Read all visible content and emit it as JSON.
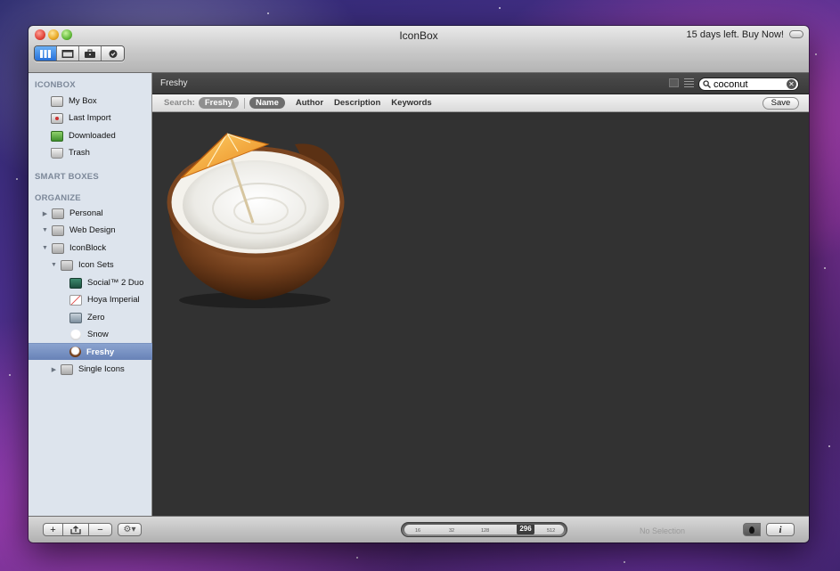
{
  "window": {
    "title": "IconBox",
    "trial_text": "15 days left.  Buy Now!"
  },
  "toolbar": {
    "segments": [
      {
        "icon": "library-icon",
        "active": true
      },
      {
        "icon": "browser-icon",
        "active": false
      },
      {
        "icon": "toolbox-icon",
        "active": false
      },
      {
        "icon": "badge-icon",
        "active": false
      }
    ]
  },
  "sidebar": {
    "sections": {
      "iconbox": "ICONBOX",
      "smart_boxes": "SMART BOXES",
      "organize": "ORGANIZE"
    },
    "iconbox_items": [
      "My Box",
      "Last Import",
      "Downloaded",
      "Trash"
    ],
    "organize_items": [
      {
        "label": "Personal",
        "expanded": false
      },
      {
        "label": "Web Design",
        "expanded": true
      },
      {
        "label": "IconBlock",
        "expanded": true
      },
      {
        "label": "Icon Sets",
        "expanded": true
      },
      {
        "label": "Social™ 2 Duo"
      },
      {
        "label": "Hoya Imperial"
      },
      {
        "label": "Zero"
      },
      {
        "label": "Snow"
      },
      {
        "label": "Freshy",
        "selected": true
      },
      {
        "label": "Single Icons",
        "expanded": false
      }
    ]
  },
  "pathbar": {
    "title": "Freshy"
  },
  "search": {
    "value": "coconut"
  },
  "scope": {
    "label": "Search:",
    "current_set": "Freshy",
    "options": [
      "Name",
      "Author",
      "Description",
      "Keywords"
    ],
    "selected_option": "Name",
    "save_label": "Save"
  },
  "bottom": {
    "add_label": "+",
    "remove_label": "−",
    "size_ticks": [
      "16",
      "32",
      "128",
      "512"
    ],
    "size_value": "296",
    "selection_status": "No Selection",
    "info_label": "i"
  }
}
